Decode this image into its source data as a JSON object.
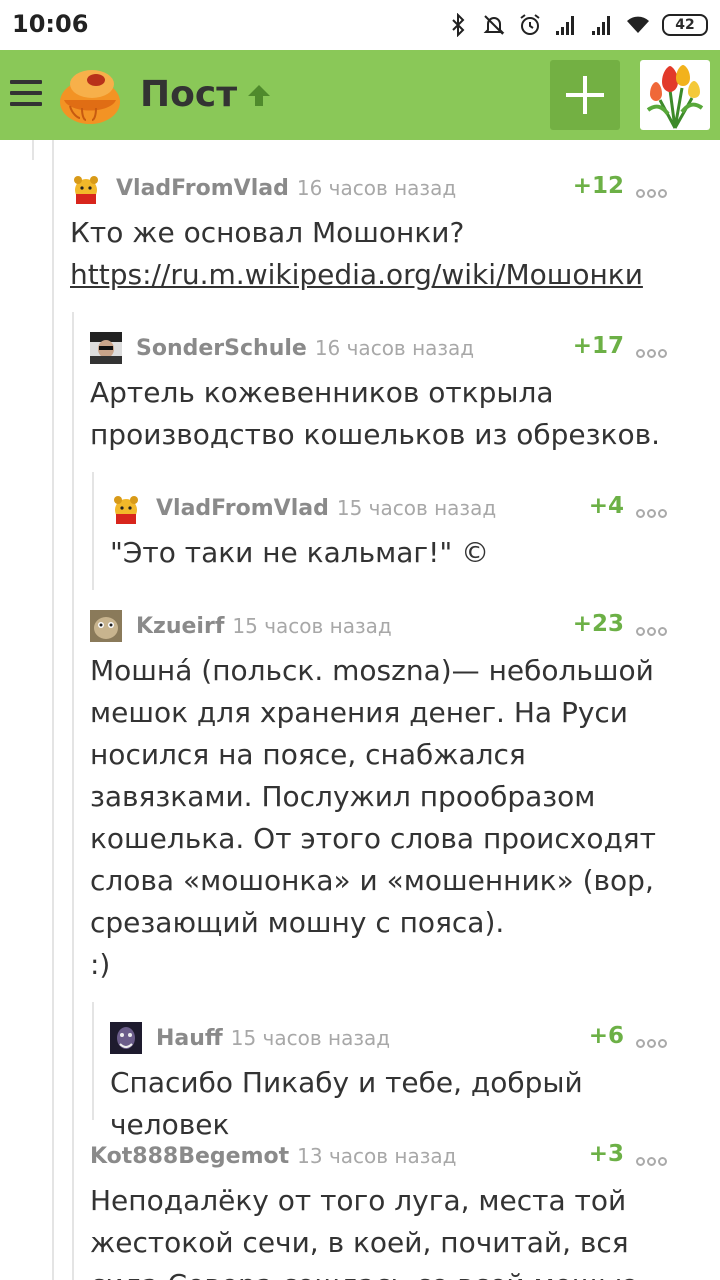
{
  "status_bar": {
    "time": "10:06",
    "battery": "42",
    "icons": [
      "bluetooth-icon",
      "mute-icon",
      "alarm-icon",
      "signal-icon",
      "signal-icon",
      "wifi-icon",
      "battery-icon"
    ]
  },
  "app_bar": {
    "title": "Пост",
    "icons": [
      "menu-icon",
      "pikabu-logo",
      "arrow-up-icon",
      "plus-icon",
      "tulips-avatar"
    ],
    "colors": {
      "bar": "#8ac858",
      "button": "#73b043"
    }
  },
  "comments": [
    {
      "author": "VladFromVlad",
      "time": "16 часов назад",
      "rating": "+12",
      "text": "Кто же основал Мошонки?",
      "link": "https://ru.m.wikipedia.org/wiki/Мошонки"
    },
    {
      "author": "SonderSchule",
      "time": "16 часов назад",
      "rating": "+17",
      "text": "Артель кожевенников открыла производство кошельков из обрезков."
    },
    {
      "author": "VladFromVlad",
      "time": "15 часов назад",
      "rating": "+4",
      "text": "\"Это таки не кальмаг!\" ©"
    },
    {
      "author": "Kzueirf",
      "time": "15 часов назад",
      "rating": "+23",
      "text": "Мошна́ (польск. moszna)— небольшой мешок для хранения денег. На Руси носился на поясе, снабжался завязками. Послужил прообразом кошелька. От этого слова происходят слова «мошонка» и «мошенник» (вор, срезающий мошну с пояса).",
      "text2": ":)"
    },
    {
      "author": "Hauff",
      "time": "15 часов назад",
      "rating": "+6",
      "text": "Спасибо Пикабу и тебе, добрый человек"
    },
    {
      "author": "Kot888Begemot",
      "time": "13 часов назад",
      "rating": "+3",
      "text": "Неподалёку от того луга, места той жестокой сечи, в коей, почитай, вся сила Севера сошлась со всей мощью"
    }
  ]
}
